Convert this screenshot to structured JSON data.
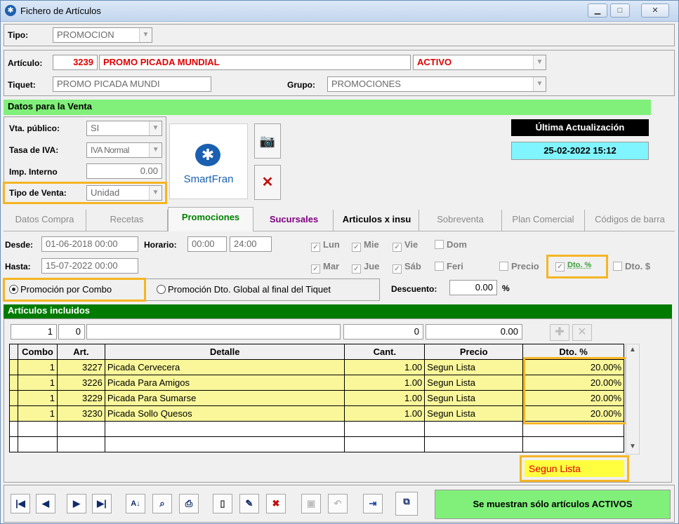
{
  "window": {
    "title": "Fichero de Artículos"
  },
  "tipo": {
    "label": "Tipo:",
    "value": "PROMOCION"
  },
  "articulo": {
    "label": "Artículo:",
    "code": "3239",
    "name": "PROMO PICADA MUNDIAL",
    "status": "ACTIVO"
  },
  "tiquet": {
    "label": "Tiquet:",
    "value": "PROMO PICADA MUNDI"
  },
  "grupo": {
    "label": "Grupo:",
    "value": "PROMOCIONES"
  },
  "venta": {
    "header": "Datos para la Venta",
    "vta_publico_label": "Vta. público:",
    "vta_publico": "SI",
    "iva_label": "Tasa de IVA:",
    "iva": "IVA Normal",
    "imp_interno_label": "Imp. Interno",
    "imp_interno": "0.00",
    "tipo_venta_label": "Tipo de Venta:",
    "tipo_venta": "Unidad",
    "logo_text": "SmartFran"
  },
  "update": {
    "label": "Última Actualización",
    "value": "25-02-2022 15:12"
  },
  "tabs": [
    "Datos Compra",
    "Recetas",
    "Promociones",
    "Sucursales",
    "Articulos x insu",
    "Sobreventa",
    "Plan Comercial",
    "Códigos de barra"
  ],
  "promo": {
    "desde_label": "Desde:",
    "desde": "01-06-2018 00:00",
    "hasta_label": "Hasta:",
    "hasta": "15-07-2022 00:00",
    "horario_label": "Horario:",
    "hora_desde": "00:00",
    "hora_hasta": "24:00",
    "days_row1": [
      "Lun",
      "Mie",
      "Vie",
      "Dom"
    ],
    "days_row2": [
      "Mar",
      "Jue",
      "Sáb",
      "Feri"
    ],
    "precio_label": "Precio",
    "dto_pct_label": "Dto. %",
    "dto_usd_label": "Dto. $",
    "radio_combo": "Promoción por Combo",
    "radio_global": "Promoción Dto. Global al final del Tiquet",
    "descuento_label": "Descuento:",
    "descuento": "0.00",
    "pct_sign": "%"
  },
  "incluidos": {
    "header": "Artículos incluidos",
    "entry": {
      "combo": "1",
      "art": "0",
      "detalle": "",
      "cant": "0",
      "precio": "0.00"
    },
    "columns": [
      "Combo",
      "Art.",
      "Detalle",
      "Cant.",
      "Precio",
      "Dto. %"
    ],
    "rows": [
      {
        "combo": "1",
        "art": "3227",
        "detalle": "Picada Cervecera",
        "cant": "1.00",
        "precio": "Segun Lista",
        "dto": "20.00%"
      },
      {
        "combo": "1",
        "art": "3226",
        "detalle": "Picada Para Amigos",
        "cant": "1.00",
        "precio": "Segun Lista",
        "dto": "20.00%"
      },
      {
        "combo": "1",
        "art": "3229",
        "detalle": "Picada Para Sumarse",
        "cant": "1.00",
        "precio": "Segun Lista",
        "dto": "20.00%"
      },
      {
        "combo": "1",
        "art": "3230",
        "detalle": "Picada Sollo Quesos",
        "cant": "1.00",
        "precio": "Segun Lista",
        "dto": "20.00%"
      }
    ],
    "footer_value": "Segun Lista"
  },
  "status_button": "Se muestran sólo artículos ACTIVOS"
}
